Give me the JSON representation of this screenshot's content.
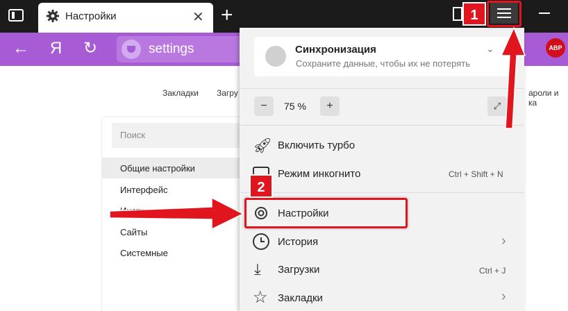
{
  "tab": {
    "title": "Настройки"
  },
  "omnibox": {
    "text": "settings"
  },
  "nav": {
    "yandex_glyph": "Я"
  },
  "bookmarks_bar": {
    "item1": "Закладки",
    "item2": "Загру",
    "item3": "ароли и ка"
  },
  "settings_sidebar": {
    "search_placeholder": "Поиск",
    "items": [
      "Общие настройки",
      "Интерфейс",
      "Инструменты",
      "Сайты",
      "Системные"
    ]
  },
  "menu": {
    "sync_title": "Синхронизация",
    "sync_subtitle": "Сохраните данные, чтобы их не потерять",
    "zoom_minus": "−",
    "zoom_value": "75 %",
    "zoom_plus": "+",
    "items": [
      {
        "label": "Включить турбо",
        "shortcut": ""
      },
      {
        "label": "Режим инкогнито",
        "shortcut": "Ctrl + Shift + N"
      },
      {
        "label": "Настройки",
        "shortcut": ""
      },
      {
        "label": "История",
        "shortcut": ""
      },
      {
        "label": "Загрузки",
        "shortcut": "Ctrl + J"
      },
      {
        "label": "Закладки",
        "shortcut": ""
      }
    ]
  },
  "extensions": {
    "abp": "ABP"
  },
  "annotations": {
    "badge1": "1",
    "badge2": "2"
  },
  "colors": {
    "accent": "#a75cd6",
    "annotation_red": "#e0151d",
    "titlebar": "#1b1b1b"
  }
}
